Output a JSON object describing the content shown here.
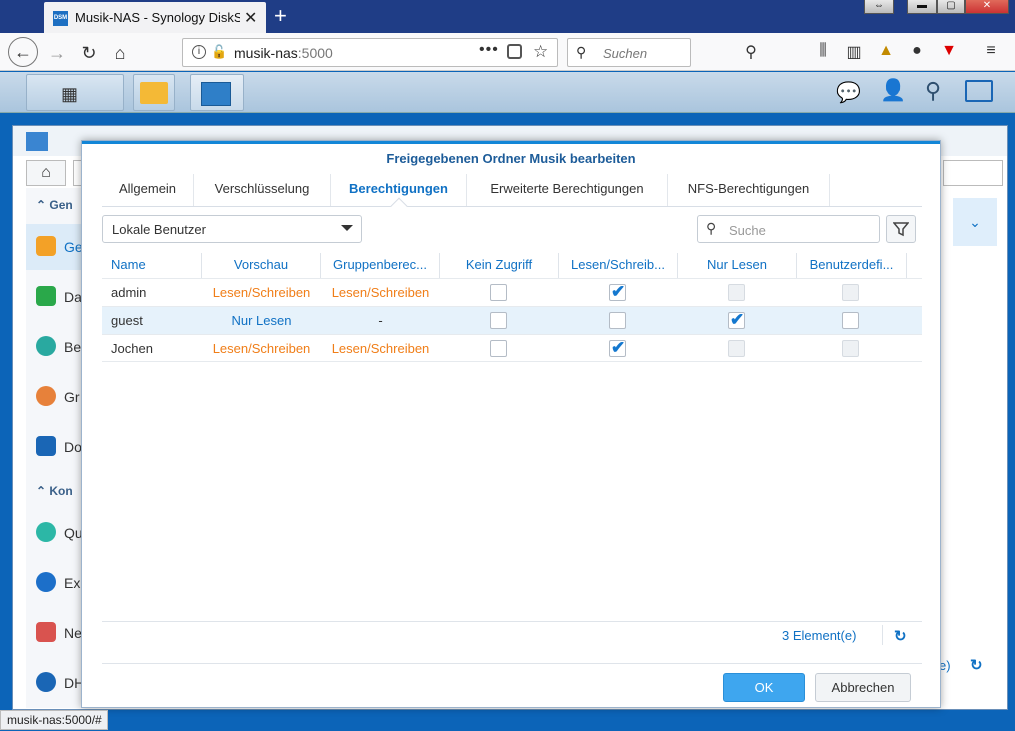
{
  "browser": {
    "tab_title": "Musik-NAS - Synology DiskStat",
    "favicon_text": "DSM",
    "url_host": "musik-nas",
    "url_port": ":5000",
    "search_placeholder": "Suchen",
    "status_url": "musik-nas:5000/#"
  },
  "sidebar": {
    "section1": "Gen",
    "section2": "Kon",
    "items": [
      {
        "label": "Ge",
        "color": "#f3a127"
      },
      {
        "label": "Da",
        "color": "#2aa84a"
      },
      {
        "label": "Be",
        "color": "#29a9a0"
      },
      {
        "label": "Gr",
        "color": "#e7813a"
      },
      {
        "label": "Do",
        "color": "#1a66b5"
      },
      {
        "label": "Qu",
        "color": "#2cb7a6"
      },
      {
        "label": "Ex",
        "color": "#1c6fc9"
      },
      {
        "label": "Ne",
        "color": "#d9534f"
      },
      {
        "label": "DH",
        "color": "#1a66b5"
      }
    ]
  },
  "bg_footer_fragment": "e)",
  "modal": {
    "title": "Freigegebenen Ordner Musik bearbeiten",
    "tabs": [
      "Allgemein",
      "Verschlüsselung",
      "Berechtigungen",
      "Erweiterte Berechtigungen",
      "NFS-Berechtigungen"
    ],
    "active_tab": "Berechtigungen",
    "user_select": "Lokale Benutzer",
    "search_placeholder": "Suche",
    "columns": [
      "Name",
      "Vorschau",
      "Gruppenberec...",
      "Kein Zugriff",
      "Lesen/Schreib...",
      "Nur Lesen",
      "Benutzerdefi..."
    ],
    "rows": [
      {
        "name": "admin",
        "preview": "Lesen/Schreiben",
        "group": "Lesen/Schreiben",
        "no_access": false,
        "rw": true,
        "ro": false,
        "custom": false
      },
      {
        "name": "guest",
        "preview": "Nur Lesen",
        "group": "-",
        "no_access": false,
        "rw": false,
        "ro": true,
        "custom": false
      },
      {
        "name": "Jochen",
        "preview": "Lesen/Schreiben",
        "group": "Lesen/Schreiben",
        "no_access": false,
        "rw": true,
        "ro": false,
        "custom": false
      }
    ],
    "count": "3 Element(e)",
    "ok": "OK",
    "cancel": "Abbrechen"
  }
}
